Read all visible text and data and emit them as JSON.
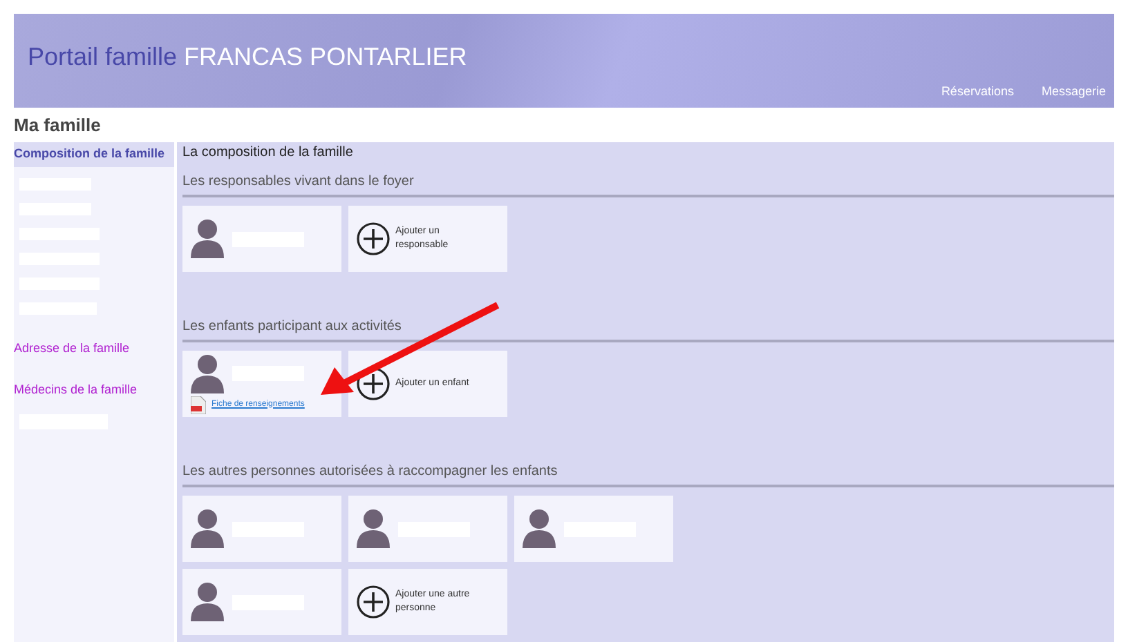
{
  "header": {
    "title_prefix": "Portail famille",
    "title_org": "FRANCAS PONTARLIER",
    "nav": [
      "Réservations",
      "Messagerie"
    ]
  },
  "page_title": "Ma famille",
  "sidebar": {
    "items": [
      {
        "label": "Composition de la famille",
        "selected": true
      },
      {
        "label": "Adresse de la famille",
        "selected": false
      },
      {
        "label": "Médecins de la famille",
        "selected": false
      }
    ]
  },
  "content": {
    "title": "La composition de la famille",
    "sections": [
      {
        "title": "Les responsables vivant dans le foyer",
        "cards": [
          {
            "kind": "person"
          },
          {
            "kind": "add",
            "label": "Ajouter un responsable"
          }
        ]
      },
      {
        "title": "Les enfants participant aux activités",
        "cards": [
          {
            "kind": "person",
            "link": "Fiche de renseignements"
          },
          {
            "kind": "add",
            "label": "Ajouter un enfant"
          }
        ]
      },
      {
        "title": "Les autres personnes autorisées à raccompagner les enfants",
        "cards": [
          {
            "kind": "person"
          },
          {
            "kind": "person"
          },
          {
            "kind": "person"
          },
          {
            "kind": "person"
          },
          {
            "kind": "add",
            "label": "Ajouter une autre personne"
          }
        ]
      }
    ]
  }
}
